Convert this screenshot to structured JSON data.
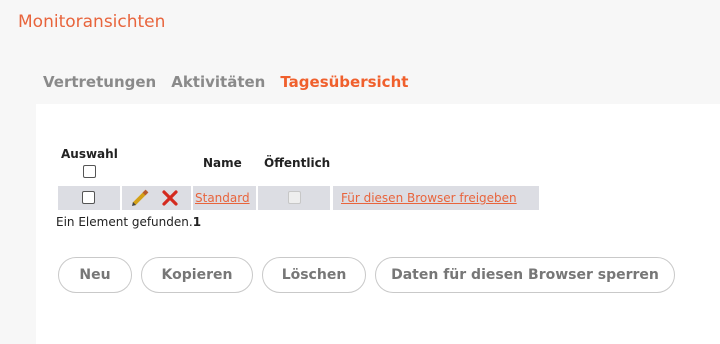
{
  "page_title": "Monitoransichten",
  "tabs": [
    {
      "label": "Vertretungen",
      "active": false
    },
    {
      "label": "Aktivitäten",
      "active": false
    },
    {
      "label": "Tagesübersicht",
      "active": true
    }
  ],
  "table": {
    "headers": {
      "select": "Auswahl",
      "name": "Name",
      "public": "Öffentlich"
    },
    "rows": [
      {
        "selected": false,
        "name": "Standard",
        "public": false,
        "action": "Für diesen Browser freigeben"
      }
    ]
  },
  "result": {
    "text": "Ein Element gefunden.",
    "count": "1"
  },
  "buttons": {
    "new": "Neu",
    "copy": "Kopieren",
    "delete": "Löschen",
    "lock": "Daten für diesen Browser sperren"
  },
  "colors": {
    "accent": "#f0602d",
    "row_bg": "#dcdde3"
  }
}
